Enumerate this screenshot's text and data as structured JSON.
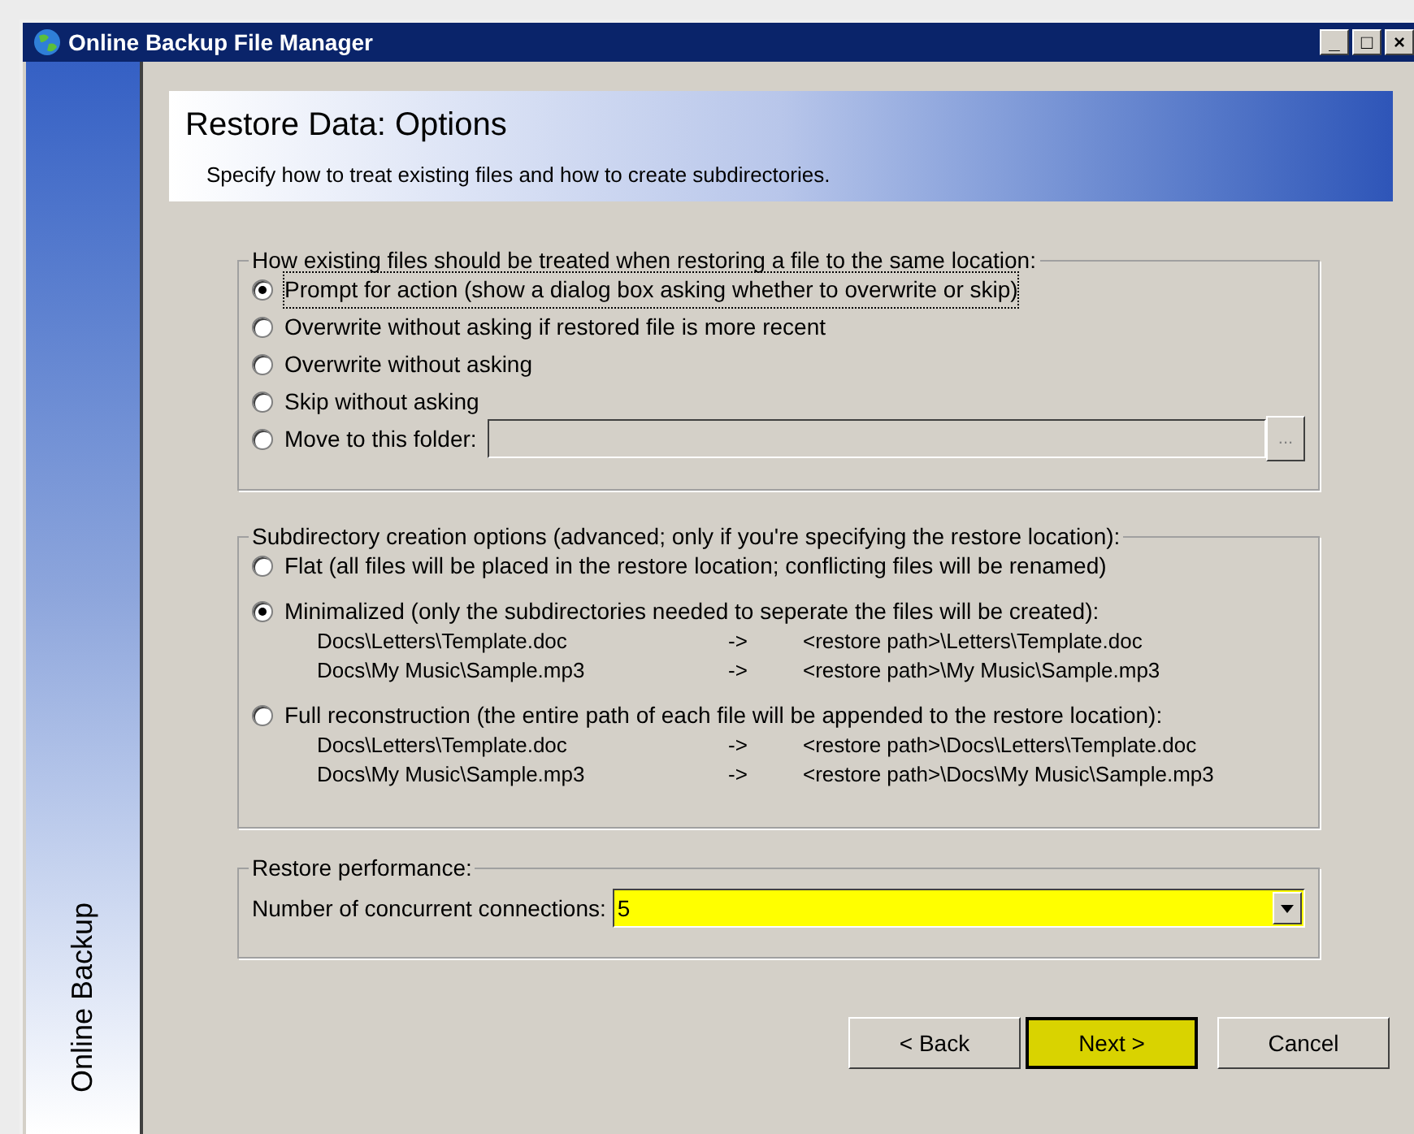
{
  "window": {
    "title": "Online Backup File Manager",
    "controls": [
      "_",
      "□",
      "×"
    ]
  },
  "sidebar": {
    "label": "Online Backup"
  },
  "header": {
    "title": "Restore Data: Options",
    "subtitle": "Specify how to treat existing files and how to create subdirectories."
  },
  "existing_files": {
    "legend": "How existing files should be treated when restoring a file to the same location:",
    "options": [
      {
        "label": "Prompt for action (show a dialog box asking whether to overwrite or skip)",
        "selected": true,
        "focused": true
      },
      {
        "label": "Overwrite without asking if restored file is more recent",
        "selected": false,
        "focused": false
      },
      {
        "label": "Overwrite without asking",
        "selected": false,
        "focused": false
      },
      {
        "label": "Skip without asking",
        "selected": false,
        "focused": false
      },
      {
        "label": "Move to this folder:",
        "selected": false,
        "focused": false,
        "folder_field": {
          "disabled": true,
          "browse": "..."
        }
      }
    ]
  },
  "subdirectory": {
    "legend": "Subdirectory creation options (advanced; only if you're specifying the restore location):",
    "options": [
      {
        "label": "Flat (all files will be placed in the restore location; conflicting files will be renamed)",
        "selected": false
      },
      {
        "label": "Minimalized (only the subdirectories needed to seperate the files will be created):",
        "selected": true,
        "examples": [
          {
            "source": "Docs\\Letters\\Template.doc",
            "arrow": "->",
            "target": "<restore path>\\Letters\\Template.doc"
          },
          {
            "source": "Docs\\My Music\\Sample.mp3",
            "arrow": "->",
            "target": "<restore path>\\My Music\\Sample.mp3"
          }
        ]
      },
      {
        "label": "Full reconstruction (the entire path of each file will be appended to the restore location):",
        "selected": false,
        "examples": [
          {
            "source": "Docs\\Letters\\Template.doc",
            "arrow": "->",
            "target": "<restore path>\\Docs\\Letters\\Template.doc"
          },
          {
            "source": "Docs\\My Music\\Sample.mp3",
            "arrow": "->",
            "target": "<restore path>\\Docs\\My Music\\Sample.mp3"
          }
        ]
      }
    ]
  },
  "performance": {
    "legend": "Restore performance:",
    "label": "Number of concurrent connections:",
    "value": "5",
    "highlighted": true
  },
  "buttons": [
    {
      "label": "< Back",
      "default": false,
      "highlighted": false
    },
    {
      "label": "Next >",
      "default": true,
      "highlighted": true
    },
    {
      "label": "Cancel",
      "default": false,
      "highlighted": false
    }
  ]
}
